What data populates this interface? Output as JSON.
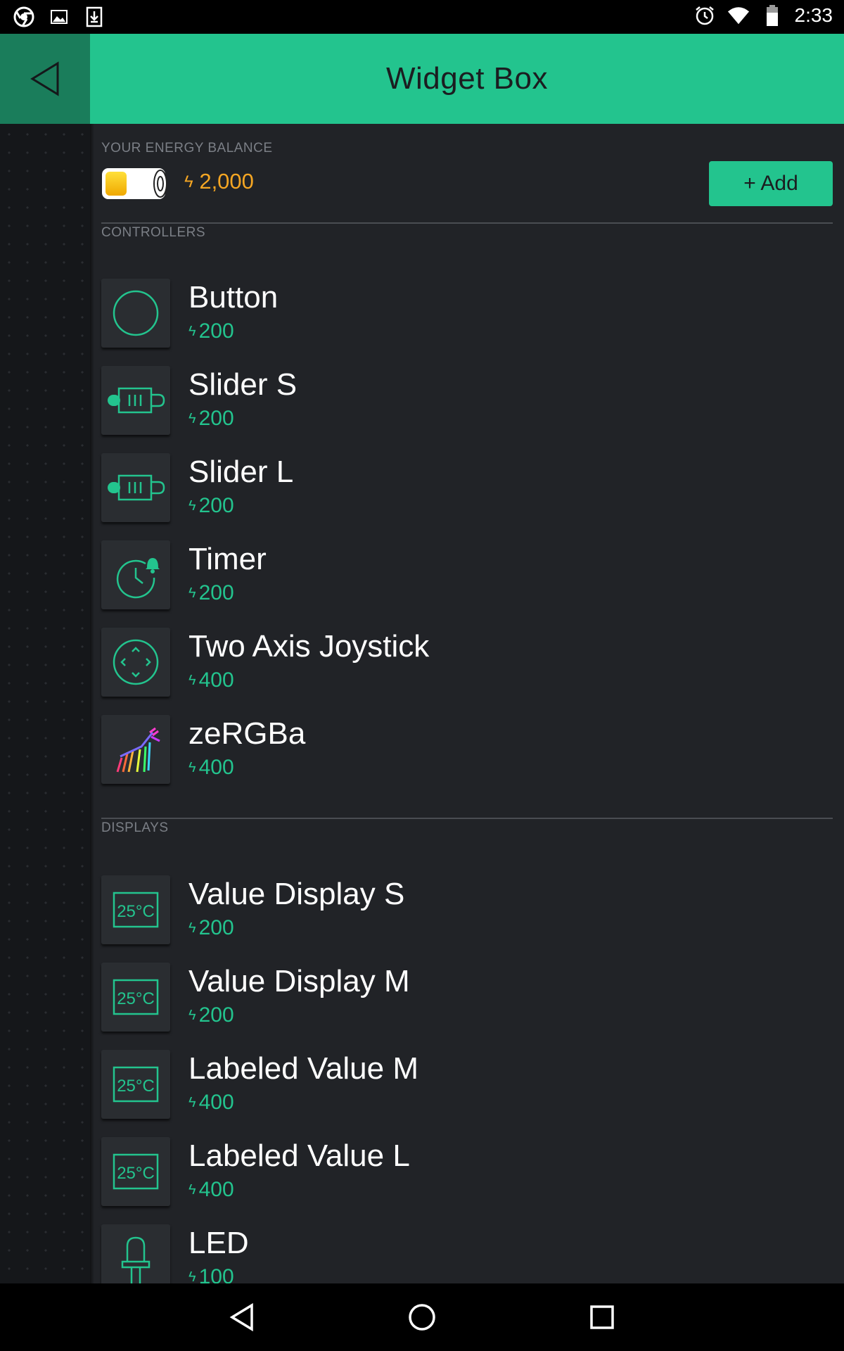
{
  "status_bar": {
    "time": "2:33",
    "left_icons": [
      "chrome-icon",
      "image-icon",
      "download-icon"
    ],
    "right_icons": [
      "alarm-icon",
      "wifi-icon",
      "battery-icon"
    ]
  },
  "header": {
    "title": "Widget Box",
    "back_icon": "back-triangle-icon"
  },
  "energy": {
    "label": "YOUR ENERGY BALANCE",
    "balance": "2,000",
    "bolt": "ϟ",
    "add_label": "+ Add",
    "balance_color": "#f5a623"
  },
  "sections": {
    "controllers_label": "CONTROLLERS",
    "displays_label": "DISPLAYS"
  },
  "controllers": [
    {
      "name": "Button",
      "cost": "200",
      "icon": "button-circle-icon"
    },
    {
      "name": "Slider S",
      "cost": "200",
      "icon": "slider-icon"
    },
    {
      "name": "Slider L",
      "cost": "200",
      "icon": "slider-icon"
    },
    {
      "name": "Timer",
      "cost": "200",
      "icon": "timer-icon"
    },
    {
      "name": "Two Axis Joystick",
      "cost": "400",
      "icon": "joystick-icon"
    },
    {
      "name": "zeRGBa",
      "cost": "400",
      "icon": "zebra-icon"
    }
  ],
  "displays": [
    {
      "name": "Value Display S",
      "cost": "200",
      "icon": "temperature-display-icon",
      "icon_text": "25°C"
    },
    {
      "name": "Value Display M",
      "cost": "200",
      "icon": "temperature-display-icon",
      "icon_text": "25°C"
    },
    {
      "name": "Labeled Value M",
      "cost": "400",
      "icon": "temperature-display-icon",
      "icon_text": "25°C"
    },
    {
      "name": "Labeled Value L",
      "cost": "400",
      "icon": "temperature-display-icon",
      "icon_text": "25°C"
    },
    {
      "name": "LED",
      "cost": "100",
      "icon": "led-icon"
    }
  ],
  "colors": {
    "accent": "#23c48e",
    "panel": "#212327",
    "energy": "#f5a623"
  },
  "nav_bar": {
    "icons": [
      "nav-back-icon",
      "nav-home-icon",
      "nav-recents-icon"
    ]
  }
}
